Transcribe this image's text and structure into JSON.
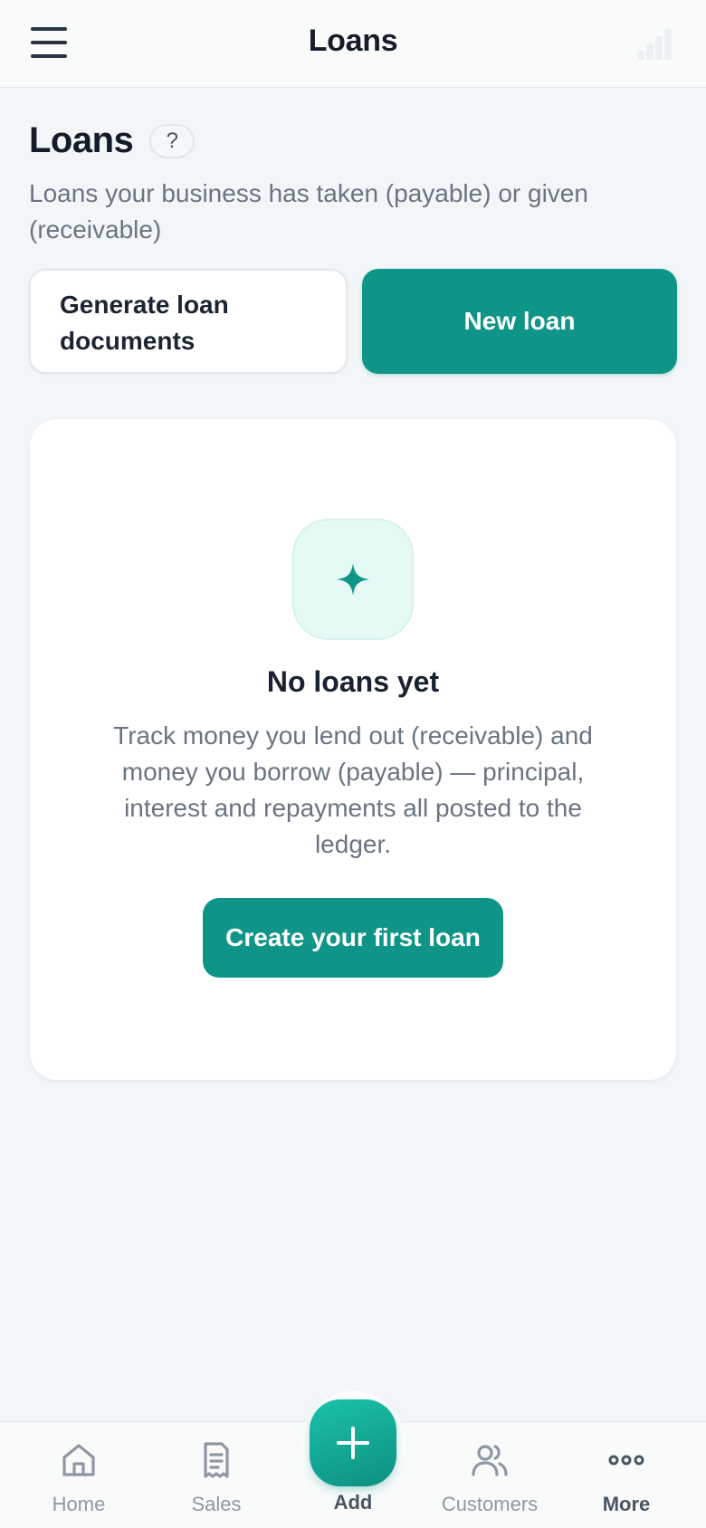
{
  "header": {
    "title": "Loans"
  },
  "page": {
    "title": "Loans",
    "help_label": "?",
    "subtitle": "Loans your business has taken (payable) or given (receivable)"
  },
  "actions": {
    "generate_label": "Generate loan documents",
    "new_loan_label": "New loan"
  },
  "empty_state": {
    "title": "No loans yet",
    "body": "Track money you lend out (receivable) and money you borrow (payable) — principal, interest and repayments all posted to the ledger.",
    "cta_label": "Create your first loan"
  },
  "bottom_nav": {
    "items": [
      {
        "label": "Home",
        "icon": "home-icon"
      },
      {
        "label": "Sales",
        "icon": "receipt-icon"
      },
      {
        "label": "Customers",
        "icon": "users-icon"
      },
      {
        "label": "More",
        "icon": "more-icon"
      }
    ],
    "add_label": "Add"
  },
  "colors": {
    "accent": "#0f9588",
    "background": "#f3f6f8",
    "card": "#ffffff",
    "muted_text": "#6a7482"
  }
}
